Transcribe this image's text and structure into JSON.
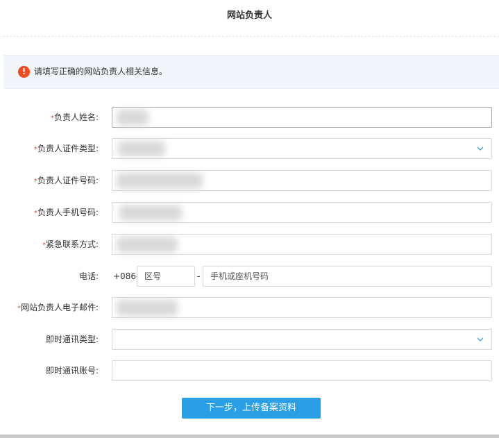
{
  "header": {
    "title": "网站负责人"
  },
  "alert": {
    "icon": "exclamation-circle-icon",
    "icon_glyph": "!",
    "text": "请填写正确的网站负责人相关信息。",
    "color": "#f04a1e"
  },
  "form": {
    "required_mark": "*",
    "fields": {
      "name": {
        "label": "负责人姓名:",
        "required": true,
        "value": "",
        "redacted": true
      },
      "id_type": {
        "label": "负责人证件类型:",
        "required": true,
        "value": "",
        "redacted": true
      },
      "id_number": {
        "label": "负责人证件号码:",
        "required": true,
        "value": "",
        "redacted": true
      },
      "mobile": {
        "label": "负责人手机号码:",
        "required": true,
        "value": "",
        "redacted": true
      },
      "emergency": {
        "label": "紧急联系方式:",
        "required": true,
        "value": "",
        "redacted": true
      },
      "phone": {
        "label": "电话:",
        "required": false,
        "prefix": "+086-",
        "area_placeholder": "区号",
        "separator": "-",
        "number_placeholder": "手机或座机号码"
      },
      "email": {
        "label": "网站负责人电子邮件:",
        "required": true,
        "value": "",
        "redacted": true
      },
      "im_type": {
        "label": "即时通讯类型:",
        "required": false,
        "value": ""
      },
      "im_account": {
        "label": "即时通讯账号:",
        "required": false,
        "value": ""
      }
    }
  },
  "actions": {
    "next_label": "下一步，上传备案资料",
    "accent": "#2a9fe6"
  }
}
